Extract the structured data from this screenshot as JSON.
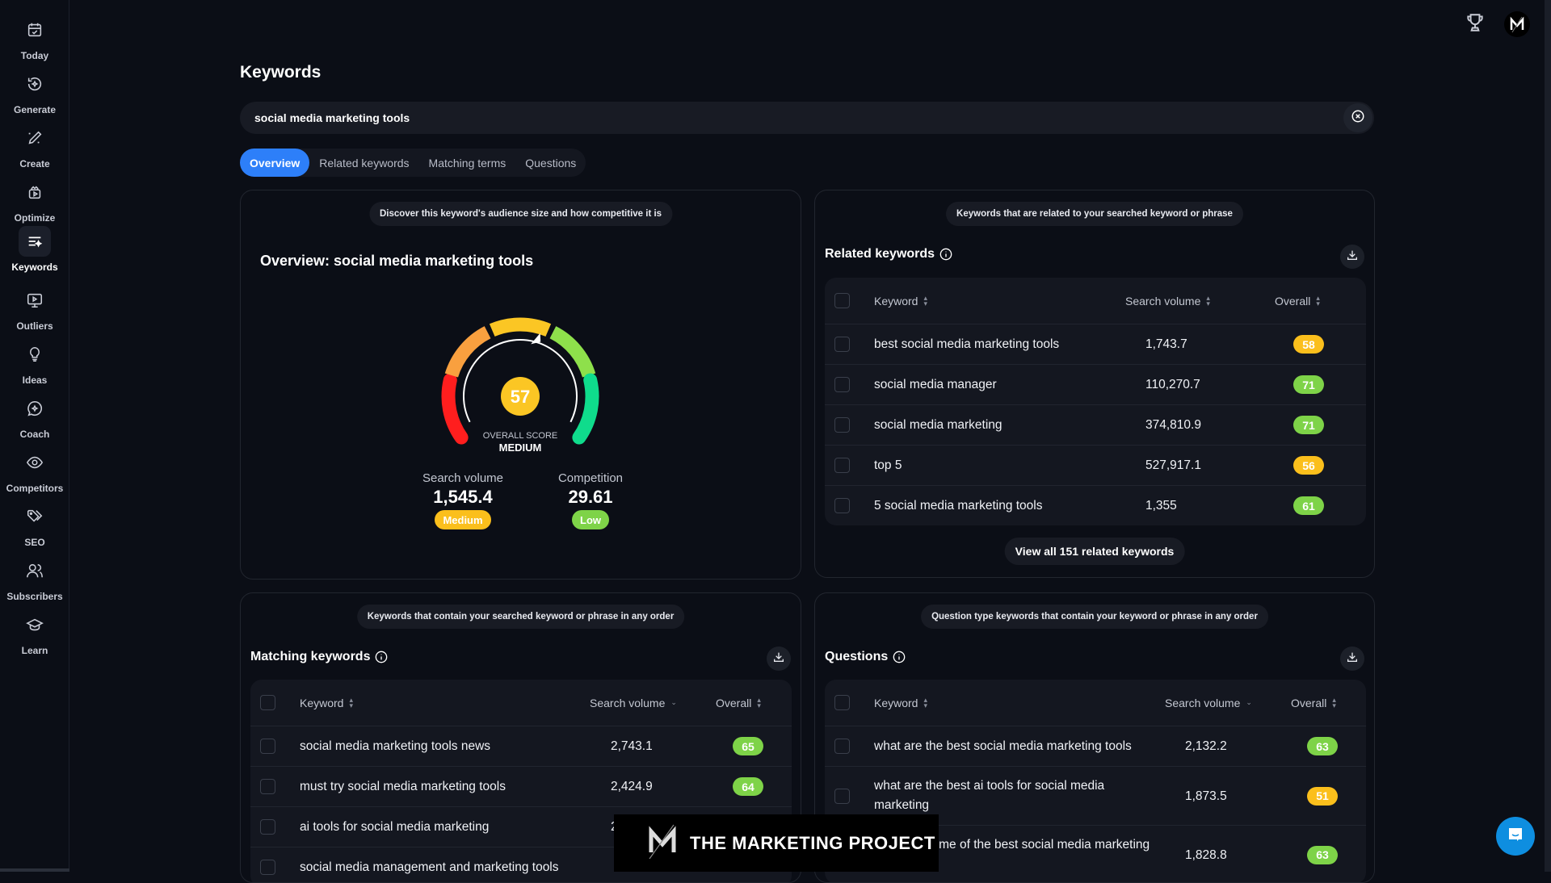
{
  "sidebar": {
    "items": [
      {
        "label": "Today",
        "icon": "calendar-check-icon"
      },
      {
        "label": "Generate",
        "icon": "refresh-sparkle-icon"
      },
      {
        "label": "Create",
        "icon": "pencil-sparkle-icon"
      },
      {
        "label": "Optimize",
        "icon": "video-box-icon"
      },
      {
        "label": "Keywords",
        "icon": "list-sparkle-icon",
        "active": true
      },
      {
        "label": "Outliers",
        "icon": "monitor-play-icon"
      },
      {
        "label": "Ideas",
        "icon": "lightbulb-icon"
      },
      {
        "label": "Coach",
        "icon": "chat-sparkle-icon"
      },
      {
        "label": "Competitors",
        "icon": "eye-icon"
      },
      {
        "label": "SEO",
        "icon": "tags-icon"
      },
      {
        "label": "Subscribers",
        "icon": "users-icon"
      },
      {
        "label": "Learn",
        "icon": "graduation-cap-icon"
      }
    ]
  },
  "topbar": {
    "trophy_icon": "trophy-icon",
    "avatar_letter": "M"
  },
  "page": {
    "title": "Keywords"
  },
  "search": {
    "value": "social media marketing tools",
    "clear_icon": "close-circle-icon"
  },
  "tabs": [
    {
      "label": "Overview",
      "active": true
    },
    {
      "label": "Related keywords"
    },
    {
      "label": "Matching terms"
    },
    {
      "label": "Questions"
    }
  ],
  "overview": {
    "hint": "Discover this keyword's audience size and how competitive it is",
    "title": "Overview: social media marketing tools",
    "gauge": {
      "score": 57,
      "score_fraction": 0.57,
      "label": "OVERALL SCORE",
      "level": "MEDIUM",
      "segment_colors": [
        "#ff1e1e",
        "#f9a03f",
        "#fbc624",
        "#8ee04b",
        "#0fdc8c"
      ]
    },
    "search_volume": {
      "label": "Search volume",
      "value": "1,545.4",
      "badge": "Medium",
      "badge_color": "#fbbf1c"
    },
    "competition": {
      "label": "Competition",
      "value": "29.61",
      "badge": "Low",
      "badge_color": "#7ed348"
    }
  },
  "related": {
    "hint": "Keywords that are related to your searched keyword or phrase",
    "title": "Related keywords",
    "columns": {
      "keyword": "Keyword",
      "volume": "Search volume",
      "overall": "Overall"
    },
    "rows": [
      {
        "keyword": "best social media marketing tools",
        "volume": "1,743.7",
        "overall": "58",
        "color": "yellow"
      },
      {
        "keyword": "social media manager",
        "volume": "110,270.7",
        "overall": "71",
        "color": "green"
      },
      {
        "keyword": "social media marketing",
        "volume": "374,810.9",
        "overall": "71",
        "color": "green"
      },
      {
        "keyword": "top 5",
        "volume": "527,917.1",
        "overall": "56",
        "color": "yellow"
      },
      {
        "keyword": "5 social media marketing tools",
        "volume": "1,355",
        "overall": "61",
        "color": "green"
      }
    ],
    "view_all": "View all 151 related keywords"
  },
  "matching": {
    "hint": "Keywords that contain your searched keyword or phrase in any order",
    "title": "Matching keywords",
    "columns": {
      "keyword": "Keyword",
      "volume": "Search volume",
      "overall": "Overall"
    },
    "rows": [
      {
        "keyword": "social media marketing tools news",
        "volume": "2,743.1",
        "overall": "65",
        "color": "green"
      },
      {
        "keyword": "must try social media marketing tools",
        "volume": "2,424.9",
        "overall": "64",
        "color": "green"
      },
      {
        "keyword": "ai tools for social media marketing",
        "volume": "2",
        "overall": "",
        "color": "green"
      },
      {
        "keyword": "social media management and marketing tools",
        "volume": "",
        "overall": "",
        "color": "yellow"
      }
    ]
  },
  "questions": {
    "hint": "Question type keywords that contain your keyword or phrase in any order",
    "title": "Questions",
    "columns": {
      "keyword": "Keyword",
      "volume": "Search volume",
      "overall": "Overall"
    },
    "rows": [
      {
        "keyword": "what are the best social media marketing tools",
        "volume": "2,132.2",
        "overall": "63",
        "color": "green"
      },
      {
        "keyword": "what are the best ai tools for social media marketing",
        "volume": "1,873.5",
        "overall": "51",
        "color": "yellow"
      },
      {
        "keyword": "what are some of the best social media marketing tools",
        "volume": "1,828.8",
        "overall": "63",
        "color": "green"
      }
    ]
  },
  "watermark": {
    "text": "THE MARKETING PROJECT"
  },
  "chat": {
    "icon": "chat-bubble-icon"
  }
}
